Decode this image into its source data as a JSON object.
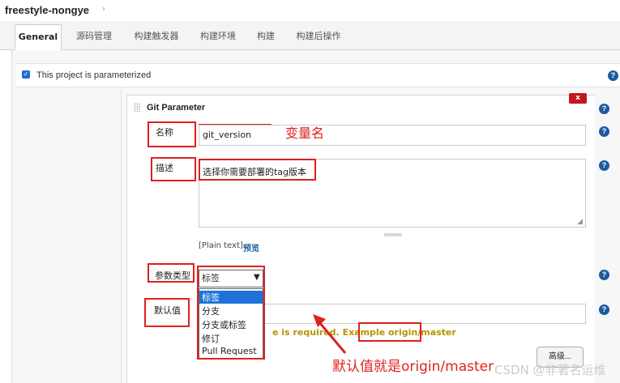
{
  "header": {
    "project_name": "freestyle-nongye",
    "crumb_arrow": "›"
  },
  "tabs": [
    {
      "label": "General",
      "active": true
    },
    {
      "label": "源码管理"
    },
    {
      "label": "构建触发器"
    },
    {
      "label": "构建环境"
    },
    {
      "label": "构建"
    },
    {
      "label": "构建后操作"
    }
  ],
  "parameterized": {
    "label": "This project is parameterized",
    "checked": true
  },
  "git_parameter": {
    "title": "Git Parameter",
    "delete_label": "x",
    "name_label": "名称",
    "name_value": "git_version",
    "desc_label": "描述",
    "desc_value": "选择你需要部署的tag版本",
    "plain_text": "[Plain text]",
    "preview": "预览",
    "type_label": "参数类型",
    "type_selected": "标签",
    "type_options": [
      "标签",
      "分支",
      "分支或标签",
      "修订",
      "Pull Request"
    ],
    "default_label": "默认值",
    "default_value": "",
    "warning": "e is required. Example origin/master",
    "advanced_label": "高级..."
  },
  "help_glyph": "?",
  "annotations": {
    "var_name": "变量名",
    "default_note": "默认值就是origin/master"
  },
  "watermark": "CSDN @非著名运维",
  "colors": {
    "annotation_red": "#e02020",
    "link_blue": "#1d5b9e",
    "warning_yellow": "#b59400",
    "select_blue": "#1e73d8",
    "delete_red": "#c4161c"
  },
  "icons": [
    "checkbox-checked-icon",
    "help-icon",
    "grip-icon",
    "chevron-down-icon",
    "resize-icon",
    "arrow-annotation-icon"
  ]
}
